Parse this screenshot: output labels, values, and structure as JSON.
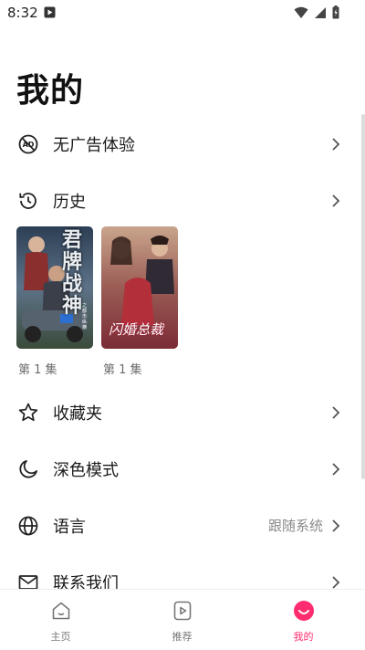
{
  "status_bar": {
    "time": "8:32"
  },
  "page": {
    "title": "我的"
  },
  "menu": {
    "no_ads": {
      "label": "无广告体验",
      "icon": "no-ads-icon"
    },
    "history": {
      "label": "历史",
      "icon": "history-icon"
    },
    "favorites": {
      "label": "收藏夹",
      "icon": "star-icon"
    },
    "dark_mode": {
      "label": "深色模式",
      "icon": "moon-icon"
    },
    "language": {
      "label": "语言",
      "value": "跟随系统",
      "icon": "globe-icon"
    },
    "contact": {
      "label": "联系我们",
      "icon": "mail-icon"
    }
  },
  "history_items": [
    {
      "poster_title": "君牌战神",
      "poster_subtitle": "之都市纵横",
      "episode": "第 1 集"
    },
    {
      "poster_title": "闪婚总裁",
      "episode": "第 1 集"
    }
  ],
  "bottom_nav": {
    "items": [
      {
        "label": "主页",
        "icon": "home-icon"
      },
      {
        "label": "推荐",
        "icon": "play-icon"
      },
      {
        "label": "我的",
        "icon": "smile-icon"
      }
    ],
    "active_index": 2
  },
  "colors": {
    "accent": "#ff2d6f",
    "text": "#1a1a1a",
    "secondary_text": "#8a8a8a"
  }
}
